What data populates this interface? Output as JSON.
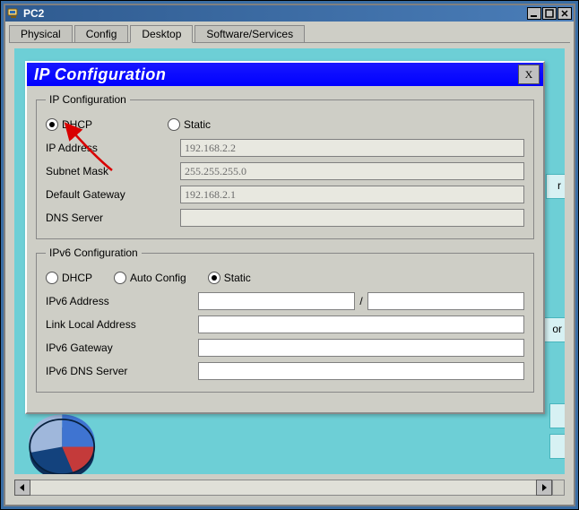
{
  "window": {
    "title": "PC2"
  },
  "tabs": {
    "physical": "Physical",
    "config": "Config",
    "desktop": "Desktop",
    "software": "Software/Services"
  },
  "dialog": {
    "title": "IP Configuration",
    "close_label": "X",
    "ipv4": {
      "legend": "IP Configuration",
      "dhcp_label": "DHCP",
      "static_label": "Static",
      "selected": "dhcp",
      "ip_label": "IP Address",
      "ip_value": "192.168.2.2",
      "mask_label": "Subnet Mask",
      "mask_value": "255.255.255.0",
      "gw_label": "Default Gateway",
      "gw_value": "192.168.2.1",
      "dns_label": "DNS Server",
      "dns_value": ""
    },
    "ipv6": {
      "legend": "IPv6 Configuration",
      "dhcp_label": "DHCP",
      "auto_label": "Auto Config",
      "static_label": "Static",
      "selected": "static",
      "addr_label": "IPv6 Address",
      "addr_value": "",
      "prefix_sep": "/",
      "prefix_value": "",
      "ll_label": "Link Local Address",
      "ll_value": "",
      "gw_label": "IPv6 Gateway",
      "gw_value": "",
      "dns_label": "IPv6 DNS Server",
      "dns_value": ""
    }
  },
  "peek": {
    "r": "r",
    "or": "or"
  }
}
